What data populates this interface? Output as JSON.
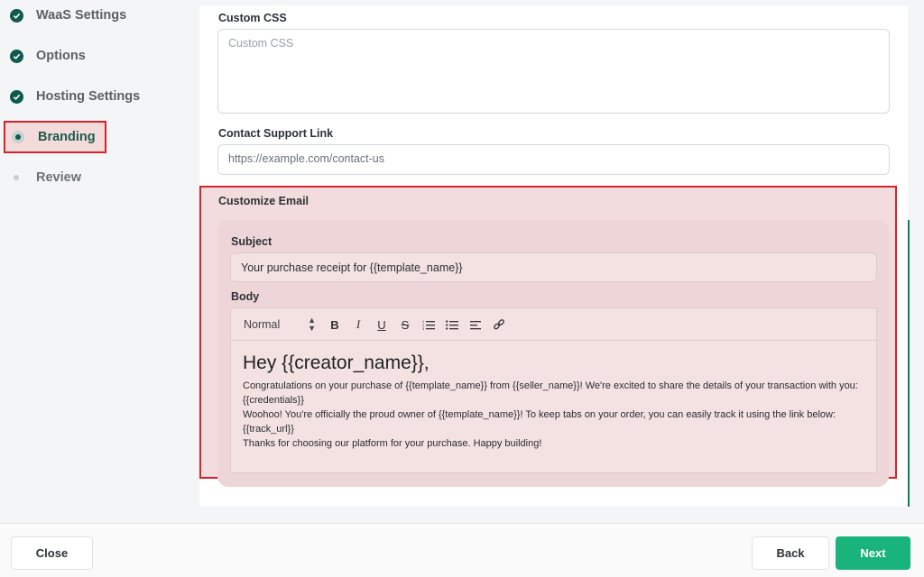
{
  "sidebar": {
    "steps": [
      {
        "label": "WaaS Settings",
        "state": "done"
      },
      {
        "label": "Options",
        "state": "done"
      },
      {
        "label": "Hosting Settings",
        "state": "done"
      },
      {
        "label": "Branding",
        "state": "active"
      },
      {
        "label": "Review",
        "state": "pending"
      }
    ]
  },
  "form": {
    "custom_css": {
      "label": "Custom CSS",
      "placeholder": "Custom CSS"
    },
    "contact_support": {
      "label": "Contact Support Link",
      "placeholder": "https://example.com/contact-us"
    },
    "customize_email": {
      "label": "Customize Email",
      "subject_label": "Subject",
      "subject_value": "Your purchase receipt for {{template_name}}",
      "body_label": "Body",
      "toolbar": {
        "format_select": "Normal",
        "icons": [
          "bold-icon",
          "italic-icon",
          "underline-icon",
          "strikethrough-icon",
          "ordered-list-icon",
          "bullet-list-icon",
          "align-icon",
          "link-icon"
        ]
      },
      "body": {
        "heading": "Hey {{creator_name}},",
        "line1": "Congratulations on your purchase of {{template_name}} from  {{seller_name}}! We're excited to share the details of your transaction with you:",
        "line2": "{{credentials}}",
        "line3": "Woohoo! You're officially the proud owner of {{template_name}}! To keep tabs on your order, you can easily track it using the link below:",
        "line4": "{{track_url}}",
        "line5": "Thanks for choosing our platform for your purchase. Happy building!"
      }
    }
  },
  "footer": {
    "close_label": "Close",
    "back_label": "Back",
    "next_label": "Next"
  },
  "colors": {
    "accent": "#18b47b",
    "done": "#0f5a4c",
    "highlight_border": "#d8232a"
  }
}
